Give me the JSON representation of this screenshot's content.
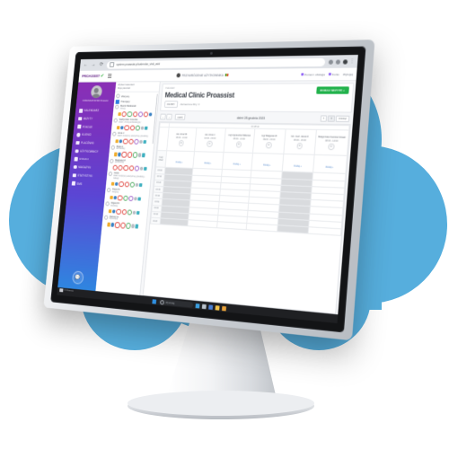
{
  "browser": {
    "back_icon": "back-arrow-icon",
    "forward_icon": "forward-arrow-icon",
    "reload_icon": "reload-icon",
    "url": "system.proassist.pl/calendar_visit_add",
    "menu_dots": "⋮"
  },
  "app_header": {
    "brand": "PROASSIST",
    "brand_check": "✔",
    "menu_icon": "hamburger-icon",
    "center_text": "PRZYWRÓCENIE UŻYTKOWNIKA",
    "links": [
      {
        "label": "Pomoc i obsługa"
      },
      {
        "label": "Konto"
      },
      {
        "label": "Wyloguj"
      }
    ]
  },
  "sidebar": {
    "user_name": "KOMUNIKATOR MD\nProassist",
    "items": [
      {
        "label": "KALENDARZ",
        "icon": "calendar-icon"
      },
      {
        "label": "WIZYTY",
        "icon": "visits-icon"
      },
      {
        "label": "POKOJE",
        "icon": "rooms-icon"
      },
      {
        "label": "KLIENCI",
        "icon": "clients-icon"
      },
      {
        "label": "PLACÓWKI",
        "icon": "facilities-icon"
      },
      {
        "label": "UŻYTKOWNICY",
        "icon": "users-icon"
      },
      {
        "label": "USŁUGI",
        "icon": "services-icon"
      },
      {
        "label": "MAGAZYN",
        "icon": "warehouse-icon"
      },
      {
        "label": "STATYSTYKI",
        "icon": "statistics-icon"
      },
      {
        "label": "SMS",
        "icon": "sms-icon"
      }
    ],
    "chat_fab_icon": "chat-bubble-icon"
  },
  "filter_panel": {
    "label_line1": "Wybierz kalendarz",
    "label_line2": "Moje placówki",
    "select_value": "Medical Clinic Proassist",
    "checkboxes": [
      {
        "label": "Wszyscy",
        "checked": false
      },
      {
        "label": "Pracujący",
        "checked": true
      }
    ],
    "doctors": [
      {
        "name": "Marcin Betkowski",
        "sub": "chirurg"
      },
      {
        "name": "Nadzyniłam Gruszka",
        "sub": "lekarz, chirurg ambulatoryjny"
      },
      {
        "name": "Anna J.",
        "sub": "lekarz medycyny estetycznej, ginekolog"
      },
      {
        "name": "Maja H.",
        "sub": "dermatolog"
      },
      {
        "name": "Małgosia M.",
        "sub": "pulmonolog"
      },
      {
        "name": "Jacek",
        "sub": "lekarz medycyny estetycznej, ginekolog - zabiegi"
      },
      {
        "name": "Paweł N.",
        "sub": "wargowy"
      },
      {
        "name": "Olgierd D.",
        "sub": "kardiolog"
      },
      {
        "name": "Dariusz D.",
        "sub": "fizjoterapia"
      }
    ]
  },
  "main": {
    "breadcrumb": "Kalendarz",
    "title": "Medical Clinic Proassist",
    "filter_button": "FILTRY",
    "filter_note": "Zaznaczone filtry: 0",
    "add_button": "DODAJ WIZYTĘ +"
  },
  "calendar": {
    "prev_label": "‹",
    "next_label": "›",
    "today_label": "DZIŚ",
    "current_date": "dzień 28 grudnia 2023",
    "views": [
      {
        "label": "1",
        "active": false
      },
      {
        "label": "3",
        "active": true
      },
      {
        "label": "miesiąc",
        "active": false
      }
    ],
    "allday_row_label": "Cały dzień",
    "weekday_band": "Cz 28.12",
    "columns": [
      {
        "title": "lek. Anna W.",
        "time": "08:00 - 14:00",
        "gear": "⚙",
        "allday": "Dodaj +",
        "blocked": true
      },
      {
        "title": "lek. Anna J.",
        "time": "10:00 - 15:00",
        "gear": "⚙",
        "allday": "Dodaj +",
        "blocked": false
      },
      {
        "title": "mgr Agnieszka Witkowk",
        "time": "08:00 - 14:00",
        "gear": "⚙",
        "allday": "Dodaj +",
        "blocked": false
      },
      {
        "title": "mgr Małgosia M.",
        "time": "09:00 - 15:00",
        "gear": "⚙",
        "allday": "Dodaj +",
        "blocked": false
      },
      {
        "title": "lek. med. Jacek Z.",
        "time": "08:00 - 16:00",
        "gear": "⚙",
        "allday": "Dodaj +",
        "blocked": true
      },
      {
        "title": "Małgorzata Kowska Nowak",
        "time": "08:00 - 14:00",
        "gear": "⚙",
        "allday": "Dodaj +",
        "blocked": false
      }
    ],
    "times": [
      "08:00",
      "08:10",
      "08:20",
      "08:30",
      "08:40",
      "08:50",
      "09:00",
      "09:10",
      "09:20"
    ]
  },
  "taskbar": {
    "start_icon": "windows-start-icon",
    "search_placeholder": "Wyszukaj",
    "search_icon": "search-icon",
    "apps": [
      {
        "name": "edge-icon",
        "color": "#3b9ddd"
      },
      {
        "name": "explorer-icon",
        "color": "#b9c2cc"
      },
      {
        "name": "store-icon",
        "color": "#4a7fd4"
      },
      {
        "name": "folder-icon",
        "color": "#f0c24b"
      },
      {
        "name": "chrome-icon",
        "color": "#e9a23b"
      }
    ],
    "tray_note": "PC\nProassist"
  },
  "colors": {
    "cloud": "#56aedd",
    "accent_green": "#22b24c",
    "sidebar_top": "#8a2fb5",
    "sidebar_bottom": "#2f86e0"
  }
}
